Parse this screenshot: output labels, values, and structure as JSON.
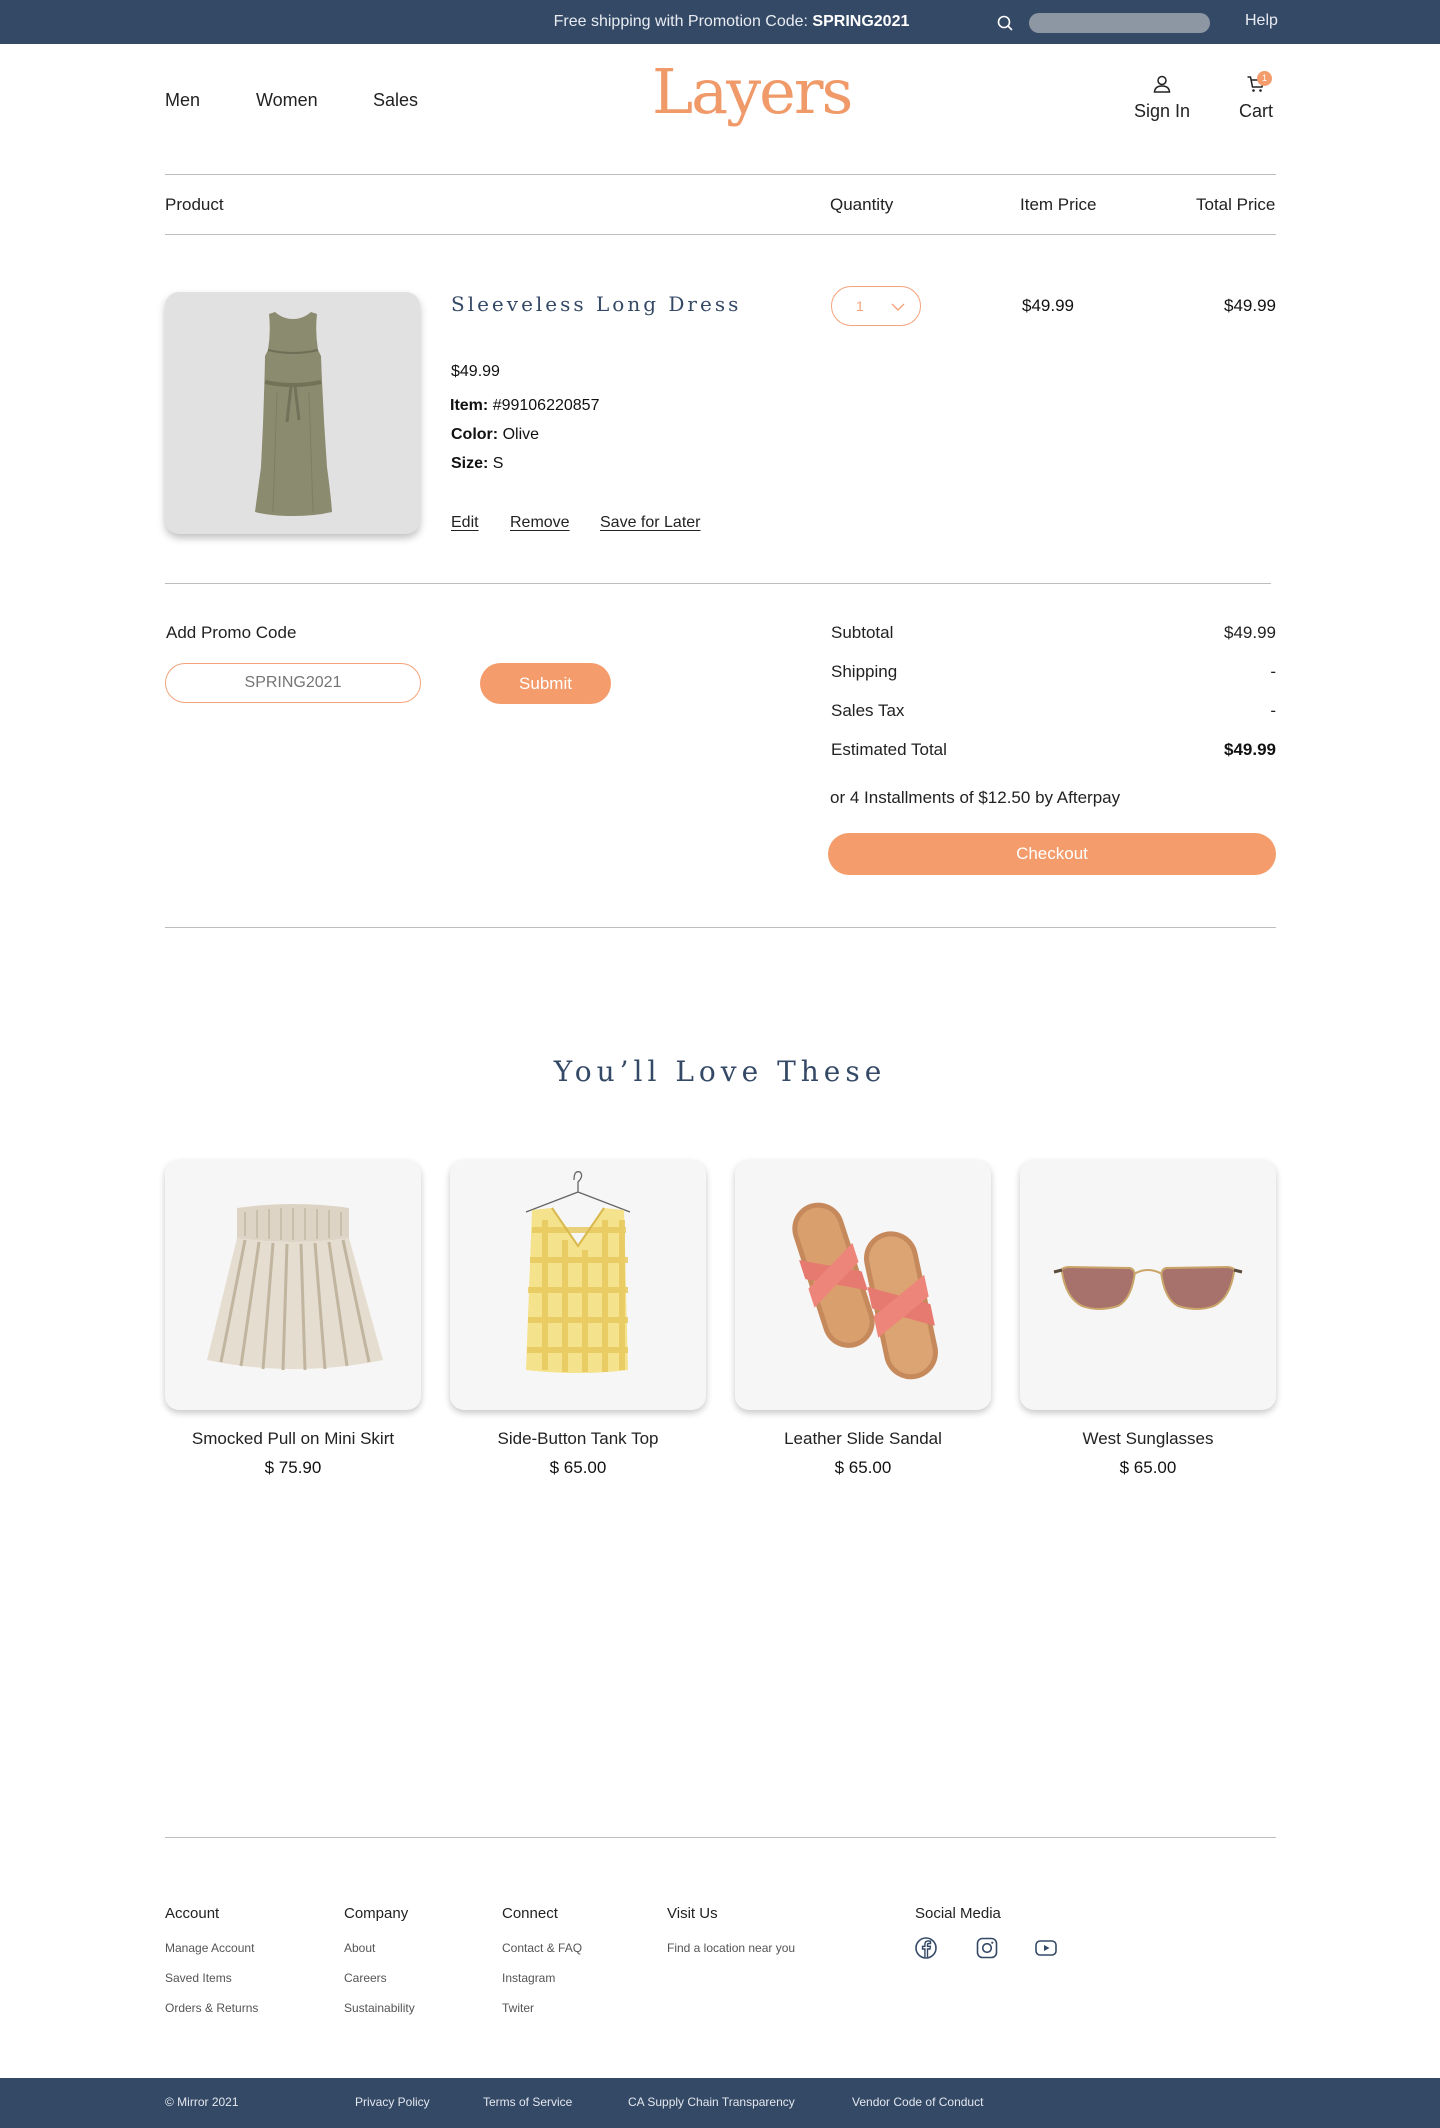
{
  "topbar": {
    "promo_prefix": "Free shipping with Promotion Code: ",
    "promo_code": "SPRING2021",
    "search_placeholder": "",
    "help": "Help"
  },
  "header": {
    "nav": [
      "Men",
      "Women",
      "Sales"
    ],
    "logo": "Layers",
    "sign_in": "Sign In",
    "cart": "Cart",
    "cart_count": "1"
  },
  "cart": {
    "columns": {
      "product": "Product",
      "quantity": "Quantity",
      "item_price": "Item Price",
      "total_price": "Total Price"
    },
    "item": {
      "name": "Sleeveless Long Dress",
      "price": "$49.99",
      "item_label": "Item:",
      "item_number": "#99106220857",
      "color_label": "Color:",
      "color": "Olive",
      "size_label": "Size:",
      "size": "S",
      "quantity": "1",
      "item_price": "$49.99",
      "total_price": "$49.99",
      "actions": {
        "edit": "Edit",
        "remove": "Remove",
        "save": "Save for Later"
      }
    }
  },
  "promo": {
    "label": "Add Promo Code",
    "placeholder": "SPRING2021",
    "submit": "Submit"
  },
  "summary": {
    "subtotal_label": "Subtotal",
    "subtotal": "$49.99",
    "shipping_label": "Shipping",
    "shipping": "-",
    "tax_label": "Sales Tax",
    "tax": "-",
    "total_label": "Estimated Total",
    "total": "$49.99",
    "afterpay": "or 4 Installments of $12.50 by Afterpay",
    "checkout": "Checkout"
  },
  "recommendations": {
    "title": "You’ll Love These",
    "items": [
      {
        "name": "Smocked Pull on Mini Skirt",
        "price": "$ 75.90"
      },
      {
        "name": "Side-Button Tank Top",
        "price": "$ 65.00"
      },
      {
        "name": "Leather Slide Sandal",
        "price": "$ 65.00"
      },
      {
        "name": "West Sunglasses",
        "price": "$ 65.00"
      }
    ]
  },
  "footer": {
    "account": {
      "title": "Account",
      "links": [
        "Manage Account",
        "Saved Items",
        "Orders & Returns"
      ]
    },
    "company": {
      "title": "Company",
      "links": [
        "About",
        "Careers",
        "Sustainability"
      ]
    },
    "connect": {
      "title": "Connect",
      "links": [
        "Contact & FAQ",
        "Instagram",
        "Twiter"
      ]
    },
    "visit": {
      "title": "Visit Us",
      "links": [
        "Find a location near you"
      ]
    },
    "social": {
      "title": "Social Media",
      "icons": [
        "facebook-icon",
        "instagram-icon",
        "youtube-icon"
      ]
    },
    "bottom": {
      "copyright": "© Mirror 2021",
      "links": [
        "Privacy Policy",
        "Terms of Service",
        "CA Supply Chain Transparency",
        "Vendor Code of Conduct"
      ]
    }
  },
  "colors": {
    "navy": "#344966",
    "accent": "#f49c6b",
    "logo": "#f09a69"
  }
}
